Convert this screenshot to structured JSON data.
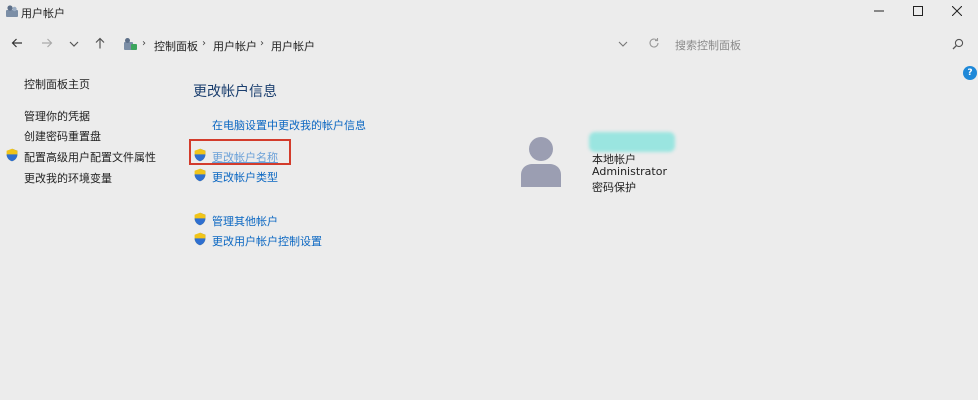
{
  "window": {
    "title": "用户帐户",
    "icons": {
      "app": "user-accounts-icon",
      "minimize": "minimize-icon",
      "maximize": "maximize-icon",
      "close": "close-icon"
    }
  },
  "navigation": {
    "back_icon": "arrow-left-icon",
    "forward_icon": "arrow-right-icon",
    "history_icon": "chevron-down-icon",
    "up_icon": "arrow-up-icon",
    "breadcrumbs": [
      "控制面板",
      "用户帐户",
      "用户帐户"
    ],
    "refresh_icon": "refresh-icon",
    "search_placeholder": "搜索控制面板"
  },
  "help": {
    "label": "?"
  },
  "sidebar": {
    "items": [
      {
        "label": "控制面板主页",
        "shield": false
      },
      {
        "label": "管理你的凭据",
        "shield": false
      },
      {
        "label": "创建密码重置盘",
        "shield": false
      },
      {
        "label": "配置高级用户配置文件属性",
        "shield": true
      },
      {
        "label": "更改我的环境变量",
        "shield": false
      }
    ]
  },
  "main": {
    "heading": "更改帐户信息",
    "pc_settings_link": "在电脑设置中更改我的帐户信息",
    "change_name": "更改帐户名称",
    "change_type": "更改帐户类型",
    "manage_other": "管理其他帐户",
    "uac_settings": "更改用户帐户控制设置"
  },
  "account": {
    "type": "本地帐户",
    "role": "Administrator",
    "password_status": "密码保护"
  },
  "colors": {
    "background": "#ececec",
    "link": "#0b67c2",
    "heading": "#1a3e6e",
    "highlight": "#d33b2b",
    "help": "#1e88d8"
  }
}
